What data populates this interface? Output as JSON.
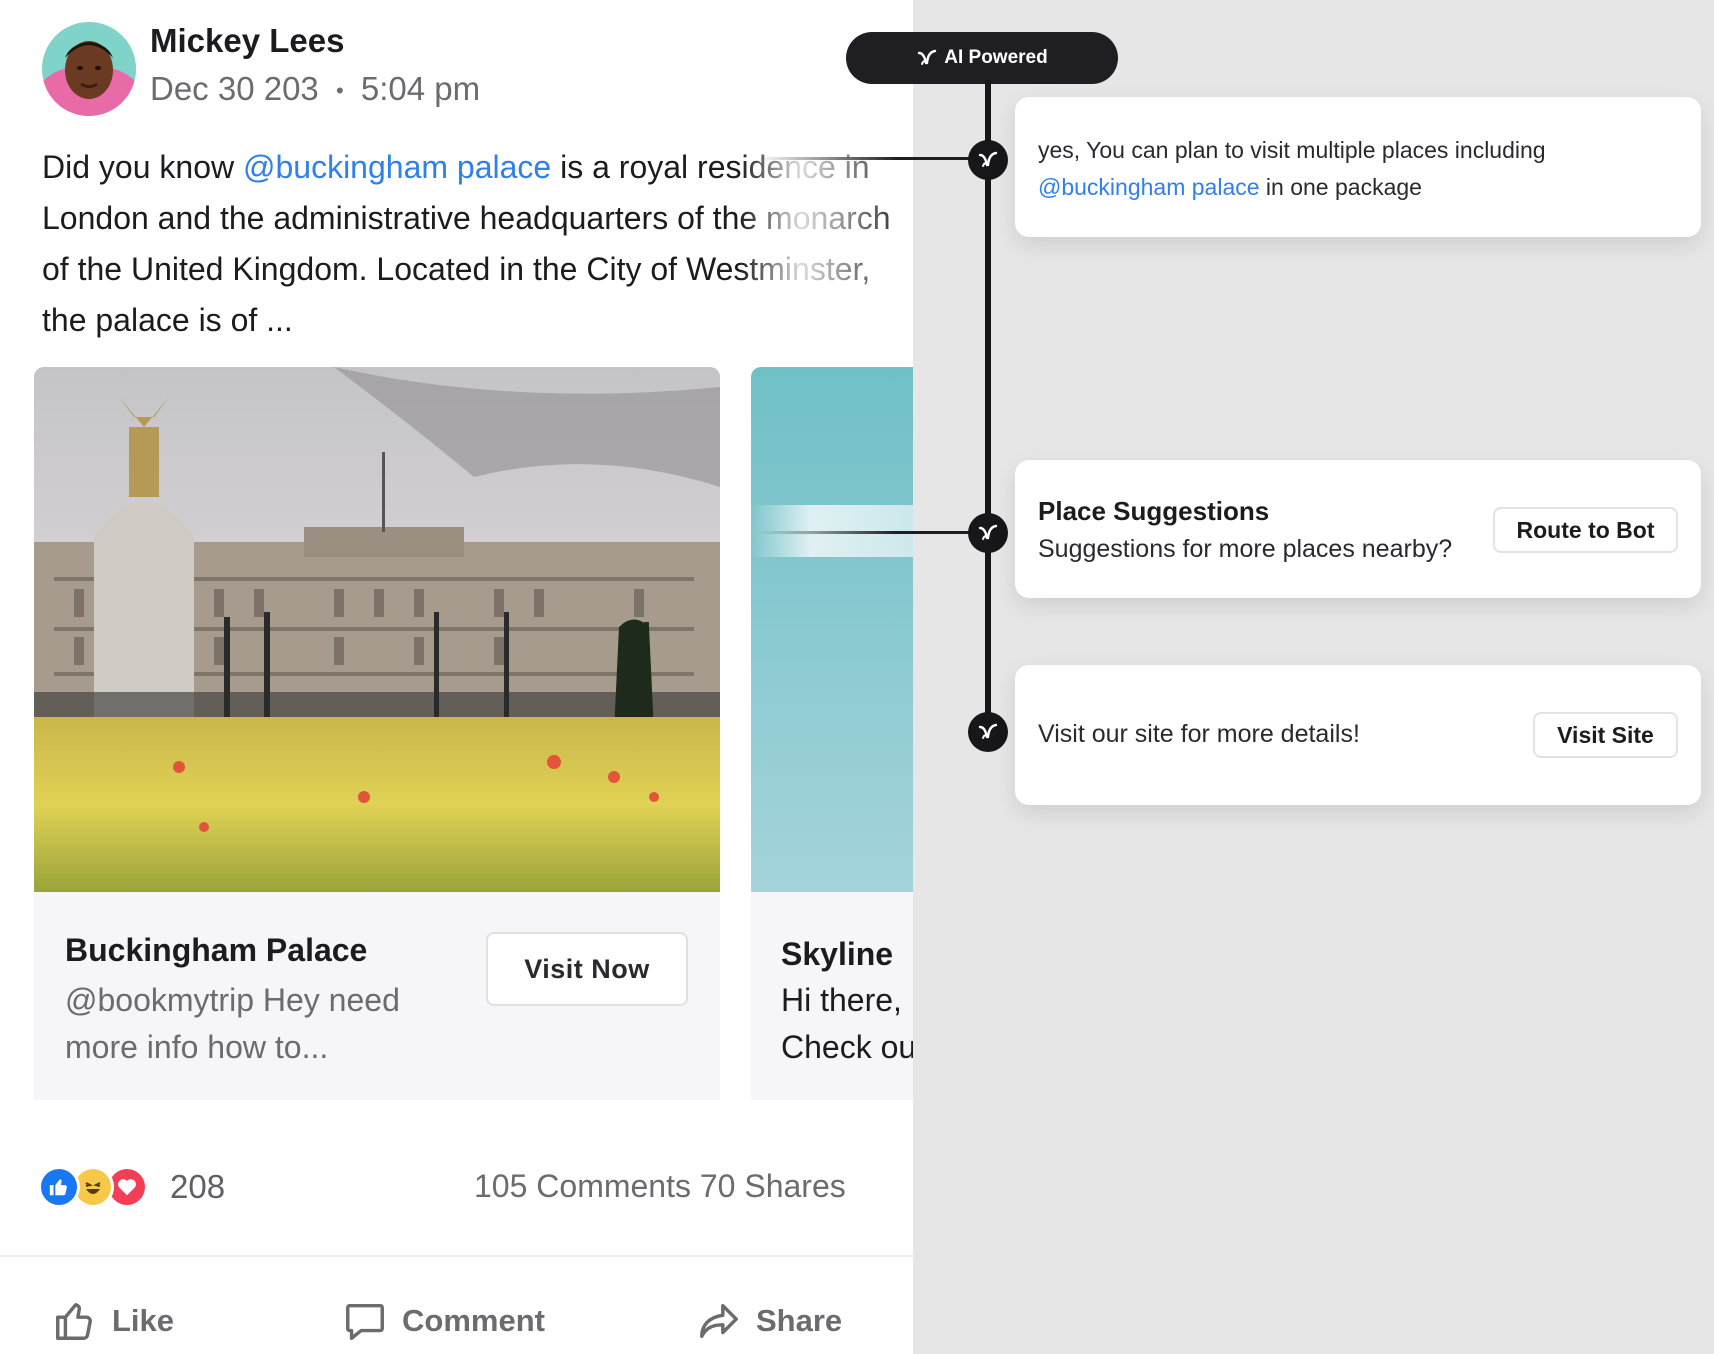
{
  "post": {
    "author_name": "Mickey Lees",
    "date": "Dec 30 203",
    "time_separator": "•",
    "time": "5:04 pm",
    "text_before_mention": "Did you know ",
    "mention": "@buckingham palace",
    "text_after_mention": " is a royal residence in London and the administrative headquarters of the monarch of the United Kingdom. Located in the City of Westminster, the palace is of ..."
  },
  "cards": [
    {
      "title": "Buckingham Palace",
      "description": "@bookmytrip Hey need more info how to...",
      "button_label": "Visit Now",
      "image": "buckingham-palace-photo"
    },
    {
      "title": "Skyline",
      "description_line1": "Hi there,",
      "description_line2": "Check ou",
      "image": "teal-skyline-photo"
    }
  ],
  "engagement": {
    "reaction_icons": [
      "like-reaction-icon",
      "haha-reaction-icon",
      "love-reaction-icon"
    ],
    "reaction_count": "208",
    "comments_shares": "105 Comments 70 Shares"
  },
  "actions": {
    "like_label": "Like",
    "comment_label": "Comment",
    "share_label": "Share"
  },
  "ai": {
    "pill_label": "AI Powered",
    "reply": {
      "text_before": "yes, You can plan to visit multiple places including ",
      "mention": "@buckingham palace",
      "text_after": " in one package"
    },
    "place_suggestions": {
      "title": "Place Suggestions",
      "description": "Suggestions for more places nearby?",
      "button_label": "Route to Bot"
    },
    "visit": {
      "text": "Visit our site for more details!",
      "button_label": "Visit Site"
    }
  },
  "colors": {
    "mention": "#2f80ed",
    "timeline": "#17171a",
    "panel_background": "#e6e6e7",
    "like_blue": "#1877f2",
    "love_red": "#f33e58",
    "haha_yellow": "#f7c948"
  }
}
